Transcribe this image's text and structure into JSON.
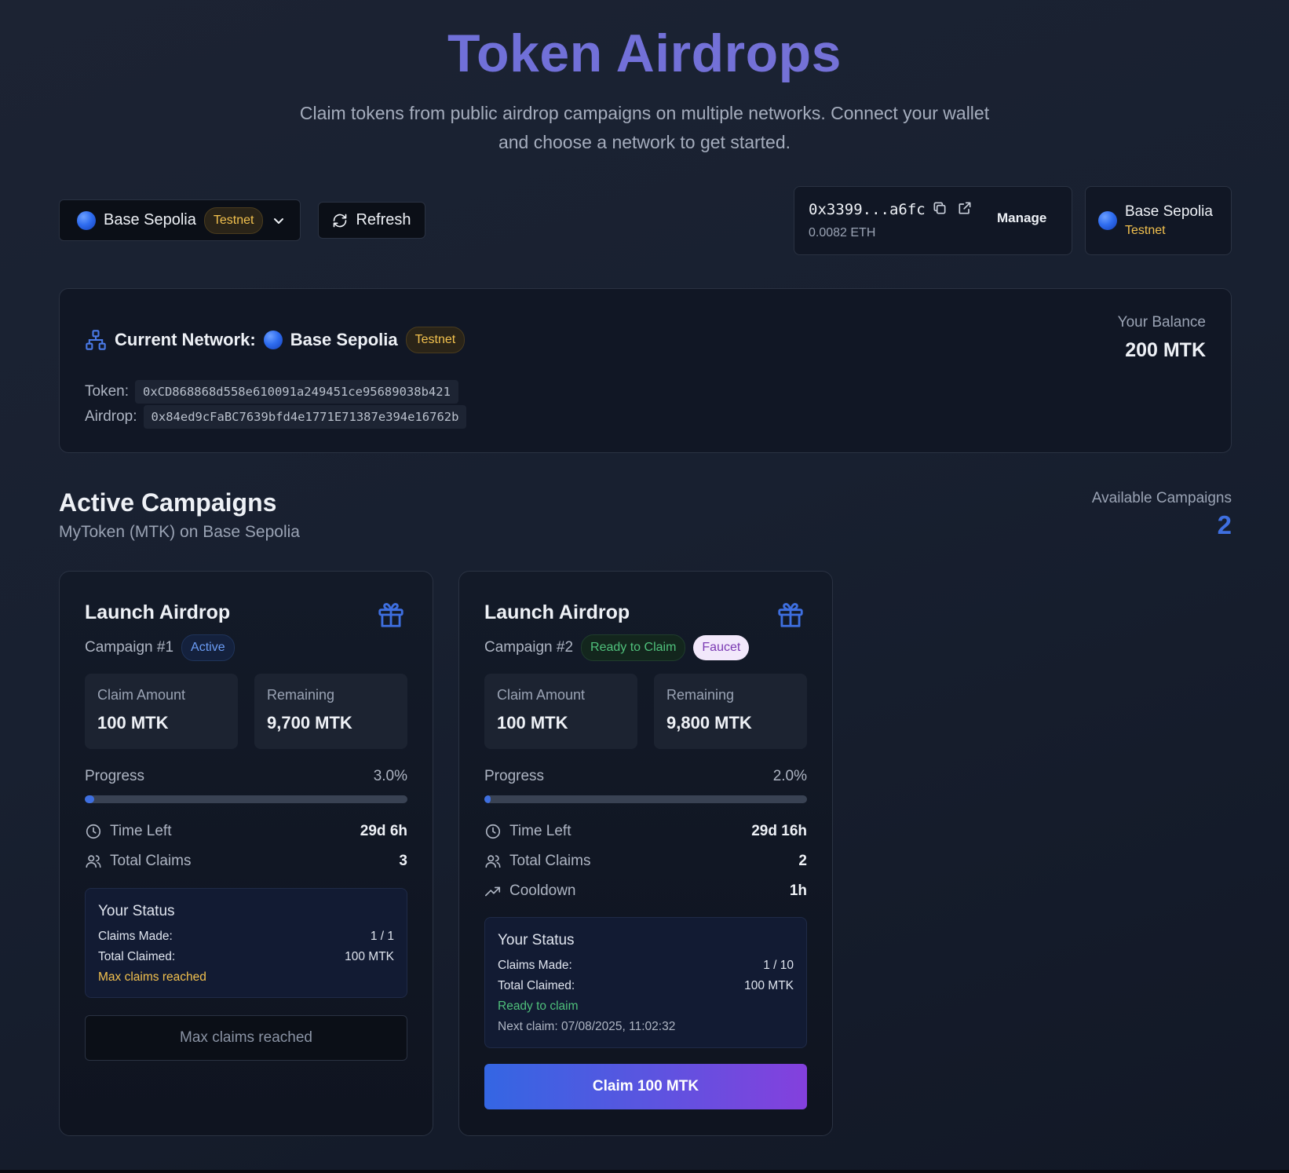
{
  "header": {
    "title": "Token Airdrops",
    "subtitle": "Claim tokens from public airdrop campaigns on multiple networks. Connect your wallet and choose a network to get started."
  },
  "toolbar": {
    "network_name": "Base Sepolia",
    "network_badge": "Testnet",
    "refresh_label": "Refresh"
  },
  "wallet": {
    "address": "0x3399...a6fc",
    "balance": "0.0082 ETH",
    "manage_label": "Manage"
  },
  "chain": {
    "name": "Base Sepolia",
    "type": "Testnet"
  },
  "network_panel": {
    "label": "Current Network:",
    "name": "Base Sepolia",
    "badge": "Testnet",
    "token_label": "Token:",
    "token_address": "0xCD868868d558e610091a249451ce95689038b421",
    "airdrop_label": "Airdrop:",
    "airdrop_address": "0x84ed9cFaBC7639bfd4e1771E71387e394e16762b",
    "balance_label": "Your Balance",
    "balance_value": "200 MTK"
  },
  "campaigns": {
    "title": "Active Campaigns",
    "subtitle": "MyToken (MTK) on Base Sepolia",
    "available_label": "Available Campaigns",
    "available_count": "2",
    "items": [
      {
        "title": "Launch Airdrop",
        "campaign_id": "Campaign #1",
        "status_badge": "Active",
        "claim_amount_label": "Claim Amount",
        "claim_amount": "100 MTK",
        "remaining_label": "Remaining",
        "remaining": "9,700 MTK",
        "progress_label": "Progress",
        "progress_text": "3.0%",
        "progress_fraction": 0.03,
        "time_left_label": "Time Left",
        "time_left": "29d 6h",
        "total_claims_label": "Total Claims",
        "total_claims": "3",
        "status_title": "Your Status",
        "claims_made_label": "Claims Made:",
        "claims_made": "1 / 1",
        "total_claimed_label": "Total Claimed:",
        "total_claimed": "100 MTK",
        "status_note": "Max claims reached",
        "button_label": "Max claims reached"
      },
      {
        "title": "Launch Airdrop",
        "campaign_id": "Campaign #2",
        "status_badge": "Ready to Claim",
        "extra_badge": "Faucet",
        "claim_amount_label": "Claim Amount",
        "claim_amount": "100 MTK",
        "remaining_label": "Remaining",
        "remaining": "9,800 MTK",
        "progress_label": "Progress",
        "progress_text": "2.0%",
        "progress_fraction": 0.02,
        "time_left_label": "Time Left",
        "time_left": "29d 16h",
        "total_claims_label": "Total Claims",
        "total_claims": "2",
        "cooldown_label": "Cooldown",
        "cooldown": "1h",
        "status_title": "Your Status",
        "claims_made_label": "Claims Made:",
        "claims_made": "1 / 10",
        "total_claimed_label": "Total Claimed:",
        "total_claimed": "100 MTK",
        "status_note": "Ready to claim",
        "next_claim": "Next claim: 07/08/2025, 11:02:32",
        "button_label": "Claim 100 MTK"
      }
    ]
  }
}
